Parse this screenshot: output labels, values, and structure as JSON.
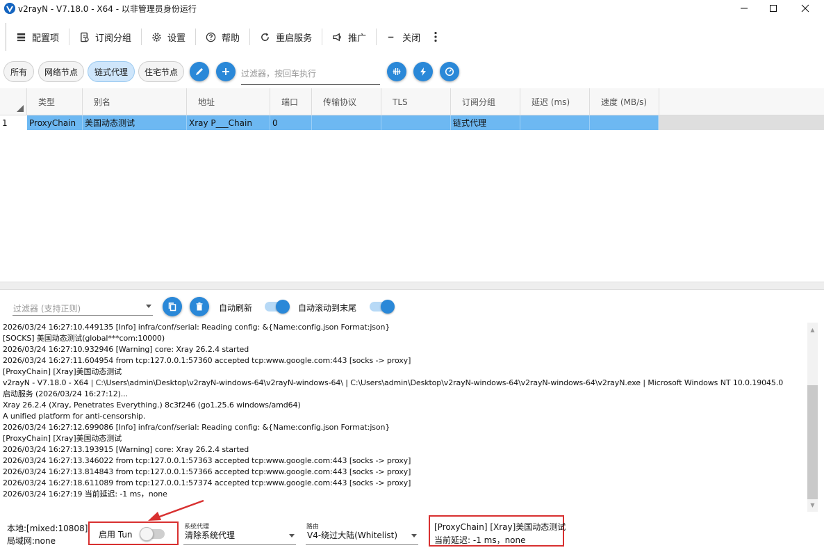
{
  "window": {
    "title": "v2rayN - V7.18.0 - X64 - 以非管理员身份运行"
  },
  "toolbar": {
    "items": [
      {
        "label": "配置项",
        "icon": "list-icon"
      },
      {
        "label": "订阅分组",
        "icon": "subscription-icon"
      },
      {
        "label": "设置",
        "icon": "gear-icon"
      },
      {
        "label": "帮助",
        "icon": "help-icon"
      },
      {
        "label": "重启服务",
        "icon": "refresh-icon"
      },
      {
        "label": "推广",
        "icon": "promote-icon"
      },
      {
        "label": "关闭",
        "icon": "minus-icon"
      }
    ]
  },
  "groups": {
    "tabs": [
      {
        "label": "所有"
      },
      {
        "label": "网络节点"
      },
      {
        "label": "链式代理"
      },
      {
        "label": "住宅节点"
      }
    ],
    "active": "链式代理",
    "filter_placeholder": "过滤器，按回车执行"
  },
  "table": {
    "columns": [
      "类型",
      "别名",
      "地址",
      "端口",
      "传输协议",
      "TLS",
      "订阅分组",
      "延迟 (ms)",
      "速度 (MB/s)"
    ],
    "rows": [
      {
        "index": "1",
        "type": "ProxyChain",
        "alias": "美国动态测试",
        "address": "Xray P___Chain",
        "port": "0",
        "transport": "",
        "tls": "",
        "subgroup": "链式代理",
        "delay": "",
        "speed": ""
      }
    ]
  },
  "log_toolbar": {
    "filter_placeholder": "过滤器 (支持正则)",
    "auto_refresh_label": "自动刷新",
    "auto_refresh_on": true,
    "auto_scroll_label": "自动滚动到末尾",
    "auto_scroll_on": true
  },
  "log": {
    "lines": [
      "2026/03/24 16:27:10.449135 [Info] infra/conf/serial: Reading config: &{Name:config.json Format:json}",
      "[SOCKS] 美国动态测试(global***com:10000)",
      "2026/03/24 16:27:10.932946 [Warning] core: Xray 26.2.4 started",
      "2026/03/24 16:27:11.604954 from tcp:127.0.0.1:57360 accepted tcp:www.google.com:443 [socks -> proxy]",
      "[ProxyChain] [Xray]美国动态测试",
      "v2rayN - V7.18.0 - X64 | C:\\Users\\admin\\Desktop\\v2rayN-windows-64\\v2rayN-windows-64\\ | C:\\Users\\admin\\Desktop\\v2rayN-windows-64\\v2rayN-windows-64\\v2rayN.exe | Microsoft Windows NT 10.0.19045.0",
      "启动服务 (2026/03/24 16:27:12)...",
      "Xray 26.2.4 (Xray, Penetrates Everything.) 8c3f246 (go1.25.6 windows/amd64)",
      "A unified platform for anti-censorship.",
      "2026/03/24 16:27:12.699086 [Info] infra/conf/serial: Reading config: &{Name:config.json Format:json}",
      "[ProxyChain] [Xray]美国动态测试",
      "2026/03/24 16:27:13.193915 [Warning] core: Xray 26.2.4 started",
      "2026/03/24 16:27:13.346022 from tcp:127.0.0.1:57363 accepted tcp:www.google.com:443 [socks -> proxy]",
      "2026/03/24 16:27:13.814843 from tcp:127.0.0.1:57366 accepted tcp:www.google.com:443 [socks -> proxy]",
      "2026/03/24 16:27:18.611089 from tcp:127.0.0.1:57374 accepted tcp:www.google.com:443 [socks -> proxy]",
      "2026/03/24 16:27:19 当前延迟: -1 ms，none"
    ]
  },
  "status": {
    "local": "本地:[mixed:10808]",
    "lan": "局域网:none",
    "tun_label": "启用 Tun",
    "tun_on": false,
    "sysproxy_caption": "系统代理",
    "sysproxy_value": "清除系统代理",
    "routing_caption": "路由",
    "routing_value": "V4-绕过大陆(Whitelist)",
    "current_server": "[ProxyChain] [Xray]美国动态测试",
    "current_delay": "当前延迟: -1 ms，none"
  },
  "colors": {
    "accent": "#2a88d8",
    "selected_row": "#6db8f2",
    "annotation_red": "#d83030"
  }
}
